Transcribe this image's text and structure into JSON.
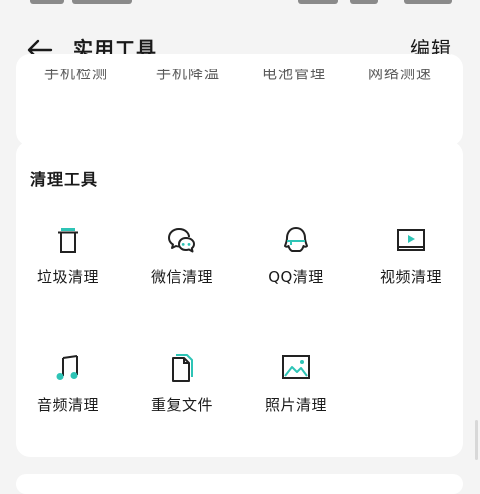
{
  "header": {
    "title": "实用工具",
    "edit_label": "编辑",
    "back_icon": "back-arrow-icon"
  },
  "top_card": {
    "items": [
      "手机检测",
      "手机降温",
      "电池管理",
      "网络测速"
    ]
  },
  "clean_tools": {
    "title": "清理工具",
    "accent_color": "#2ec4b6",
    "items": [
      {
        "label": "垃圾清理",
        "icon": "trash-icon"
      },
      {
        "label": "微信清理",
        "icon": "wechat-icon"
      },
      {
        "label": "QQ清理",
        "icon": "qq-icon"
      },
      {
        "label": "视频清理",
        "icon": "video-icon"
      },
      {
        "label": "音频清理",
        "icon": "music-icon"
      },
      {
        "label": "重复文件",
        "icon": "duplicate-file-icon"
      },
      {
        "label": "照片清理",
        "icon": "photo-icon"
      }
    ]
  }
}
